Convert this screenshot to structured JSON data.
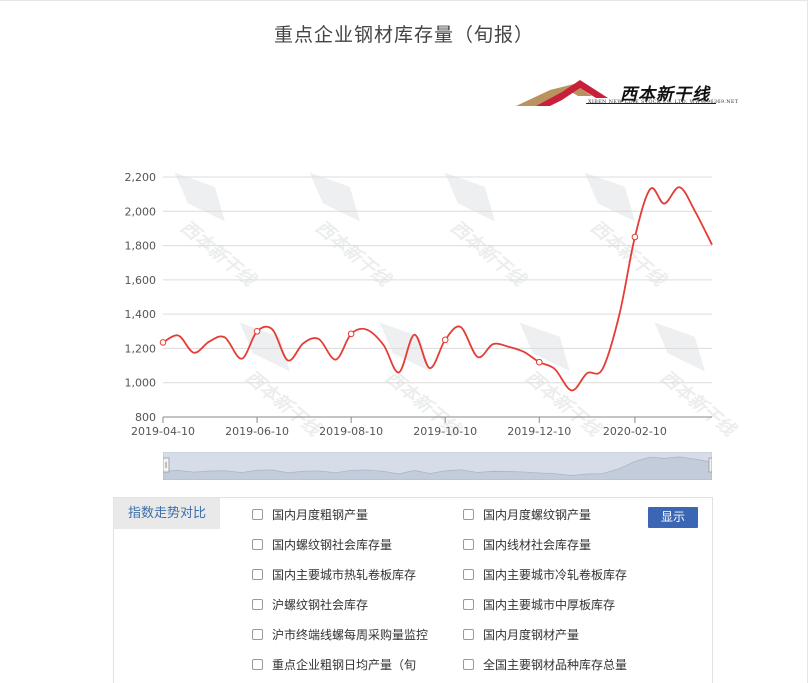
{
  "title": "重点企业钢材库存量（旬报）",
  "logo": {
    "text": "西本新干线",
    "subtext": "XIBEN NEW LINE STOCK CO.,LTD.  WWW.96369.NET",
    "watermark": "西本新干线"
  },
  "colors": {
    "line": "#e53c35",
    "grid": "#dcdcdc",
    "axis": "#6f6f6f",
    "navigator_fill": "#d6dde8",
    "button": "#3b66b3",
    "panel_label": "#3d6ea8"
  },
  "chart_data": {
    "type": "line",
    "title": "重点企业钢材库存量（旬报）",
    "xlabel": "",
    "ylabel": "",
    "ylim": [
      800,
      2200
    ],
    "yticks": [
      800,
      1000,
      1200,
      1400,
      1600,
      1800,
      2000,
      2200
    ],
    "ytick_labels": [
      "800",
      "1,000",
      "1,200",
      "1,400",
      "1,600",
      "1,800",
      "2,000",
      "2,200"
    ],
    "xtick_labels": [
      "2019-04-10",
      "2019-06-10",
      "2019-08-10",
      "2019-10-10",
      "2019-12-10",
      "2020-02-10"
    ],
    "grid": true,
    "series": [
      {
        "name": "",
        "x": [
          "2019-04-10",
          "2019-04-20",
          "2019-04-30",
          "2019-05-10",
          "2019-05-20",
          "2019-05-31",
          "2019-06-10",
          "2019-06-20",
          "2019-06-30",
          "2019-07-10",
          "2019-07-20",
          "2019-07-31",
          "2019-08-10",
          "2019-08-20",
          "2019-08-31",
          "2019-09-10",
          "2019-09-20",
          "2019-09-30",
          "2019-10-10",
          "2019-10-20",
          "2019-10-31",
          "2019-11-10",
          "2019-11-20",
          "2019-11-30",
          "2019-12-10",
          "2019-12-20",
          "2019-12-31",
          "2020-01-10",
          "2020-01-20",
          "2020-01-31",
          "2020-02-10",
          "2020-02-20",
          "2020-02-29",
          "2020-03-10",
          "2020-03-20",
          "2020-03-31"
        ],
        "values": [
          1235,
          1275,
          1175,
          1240,
          1265,
          1140,
          1300,
          1310,
          1130,
          1230,
          1255,
          1135,
          1285,
          1310,
          1220,
          1060,
          1280,
          1085,
          1250,
          1325,
          1150,
          1225,
          1210,
          1180,
          1120,
          1080,
          955,
          1055,
          1080,
          1400,
          1850,
          2130,
          2045,
          2140,
          2000,
          1805
        ]
      }
    ]
  },
  "navigator": {
    "handle_left": "≡",
    "handle_right": ""
  },
  "panel": {
    "label": "指数走势对比",
    "button": "显示",
    "options": [
      [
        "国内月度粗钢产量",
        "国内月度螺纹钢产量"
      ],
      [
        "国内螺纹钢社会库存量",
        "国内线材社会库存量"
      ],
      [
        "国内主要城市热轧卷板库存",
        "国内主要城市冷轧卷板库存"
      ],
      [
        "沪螺纹钢社会库存",
        "国内主要城市中厚板库存"
      ],
      [
        "沪市终端线螺每周采购量监控",
        "国内月度钢材产量"
      ],
      [
        "重点企业粗钢日均产量（旬",
        "全国主要钢材品种库存总量"
      ]
    ]
  }
}
